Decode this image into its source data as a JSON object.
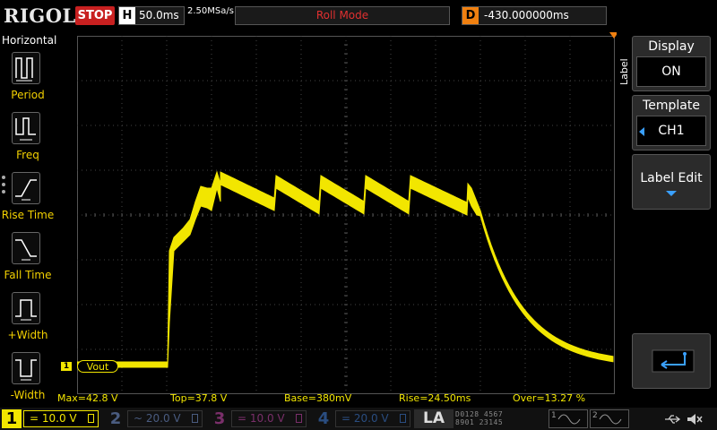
{
  "header": {
    "brand": "RIGOL",
    "run_state": "STOP",
    "horizontal_tag": "H",
    "timebase": "50.0ms",
    "sample_rate": "2.50MSa/s",
    "mode": "Roll Mode",
    "delay_tag": "D",
    "delay": "-430.000000ms"
  },
  "left_menu": {
    "title": "Horizontal",
    "items": [
      {
        "label": "Period",
        "icon": "period-icon"
      },
      {
        "label": "Freq",
        "icon": "frequency-icon"
      },
      {
        "label": "Rise Time",
        "icon": "rise-time-icon"
      },
      {
        "label": "Fall Time",
        "icon": "fall-time-icon"
      },
      {
        "label": "+Width",
        "icon": "positive-width-icon"
      },
      {
        "label": "-Width",
        "icon": "negative-width-icon"
      }
    ]
  },
  "waveform": {
    "channel_marker": "1",
    "channel_label": "Vout",
    "color": "#f2e600",
    "shape": "rising-edge plateau with sawtooth ripple, then exponential decay"
  },
  "measurements": {
    "max": "Max=42.8 V",
    "top": "Top=37.8 V",
    "base": "Base=380mV",
    "rise": "Rise=24.50ms",
    "over": "Over=13.27 %"
  },
  "right_menu": {
    "tab_label": "Label",
    "display": {
      "title": "Display",
      "value": "ON"
    },
    "template": {
      "title": "Template",
      "value": "CH1"
    },
    "label_edit": {
      "title": "Label Edit"
    },
    "back_icon": "return-arrow-icon"
  },
  "channels": [
    {
      "num": "1",
      "scale": "10.0 V",
      "coupling": "DC",
      "color": "#f2e600",
      "active": true
    },
    {
      "num": "2",
      "scale": "20.0 V",
      "coupling": "AC",
      "color": "#4a5c80",
      "active": false
    },
    {
      "num": "3",
      "scale": "10.0 V",
      "coupling": "DC",
      "color": "#7a2f6a",
      "active": false
    },
    {
      "num": "4",
      "scale": "20.0 V",
      "coupling": "DC",
      "color": "#2a4d80",
      "active": false
    }
  ],
  "bottom": {
    "la_label": "LA",
    "digital_row1": "D0128 4567",
    "digital_row2": "8901 23145",
    "gen1": "1",
    "gen2": "2",
    "usb_icon": "usb-icon",
    "speaker_icon": "speaker-muted-icon"
  }
}
